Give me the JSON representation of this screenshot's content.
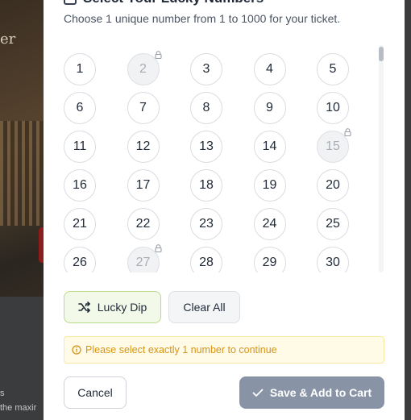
{
  "background": {
    "hero_text": "er",
    "lower_text_line1": "s",
    "lower_text_line2": "the maxir"
  },
  "modal": {
    "title": "Select Your Lucky Numbers",
    "subtitle": "Choose 1 unique number from 1 to 1000 for your ticket.",
    "numbers": [
      {
        "label": "1",
        "locked": false
      },
      {
        "label": "2",
        "locked": true
      },
      {
        "label": "3",
        "locked": false
      },
      {
        "label": "4",
        "locked": false
      },
      {
        "label": "5",
        "locked": false
      },
      {
        "label": "6",
        "locked": false
      },
      {
        "label": "7",
        "locked": false
      },
      {
        "label": "8",
        "locked": false
      },
      {
        "label": "9",
        "locked": false
      },
      {
        "label": "10",
        "locked": false
      },
      {
        "label": "11",
        "locked": false
      },
      {
        "label": "12",
        "locked": false
      },
      {
        "label": "13",
        "locked": false
      },
      {
        "label": "14",
        "locked": false
      },
      {
        "label": "15",
        "locked": true
      },
      {
        "label": "16",
        "locked": false
      },
      {
        "label": "17",
        "locked": false
      },
      {
        "label": "18",
        "locked": false
      },
      {
        "label": "19",
        "locked": false
      },
      {
        "label": "20",
        "locked": false
      },
      {
        "label": "21",
        "locked": false
      },
      {
        "label": "22",
        "locked": false
      },
      {
        "label": "23",
        "locked": false
      },
      {
        "label": "24",
        "locked": false
      },
      {
        "label": "25",
        "locked": false
      },
      {
        "label": "26",
        "locked": false
      },
      {
        "label": "27",
        "locked": true
      },
      {
        "label": "28",
        "locked": false
      },
      {
        "label": "29",
        "locked": false
      },
      {
        "label": "30",
        "locked": false
      }
    ],
    "lucky_dip_label": "Lucky Dip",
    "clear_all_label": "Clear All",
    "warning_text": "Please select exactly 1 number to continue",
    "cancel_label": "Cancel",
    "save_label": "Save & Add to Cart"
  },
  "colors": {
    "accent_green_border": "#b7dc8a",
    "warning_text": "#d89313",
    "save_button_disabled": "#8894a6"
  }
}
